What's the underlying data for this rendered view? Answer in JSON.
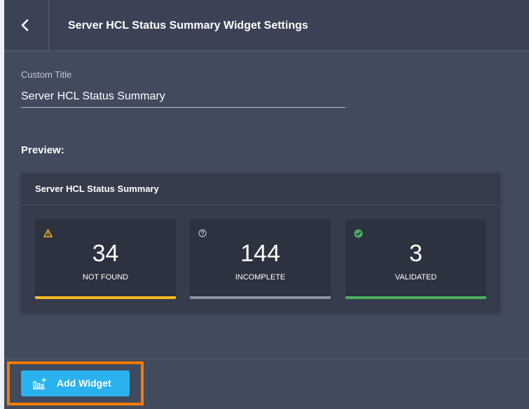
{
  "header": {
    "title": "Server HCL Status Summary Widget Settings",
    "back_icon": "chevron-left-icon"
  },
  "form": {
    "custom_title_label": "Custom Title",
    "custom_title_value": "Server HCL Status Summary"
  },
  "preview": {
    "label": "Preview:",
    "card_title": "Server HCL Status Summary",
    "tiles": [
      {
        "value": "34",
        "label": "NOT FOUND",
        "icon": "warning-icon",
        "color": "#f5b921"
      },
      {
        "value": "144",
        "label": "INCOMPLETE",
        "icon": "question-circle-icon",
        "color": "#8a92a3"
      },
      {
        "value": "3",
        "label": "VALIDATED",
        "icon": "check-circle-icon",
        "color": "#4cb05f"
      }
    ]
  },
  "footer": {
    "add_widget_label": "Add Widget",
    "add_widget_icon": "add-chart-icon"
  },
  "colors": {
    "panel_bg": "#424a5e",
    "header_bg": "#3b4255",
    "card_bg": "#363c4c",
    "tile_bg": "#2d3241",
    "accent_button": "#2ab2ee",
    "highlight": "#f57c00"
  }
}
